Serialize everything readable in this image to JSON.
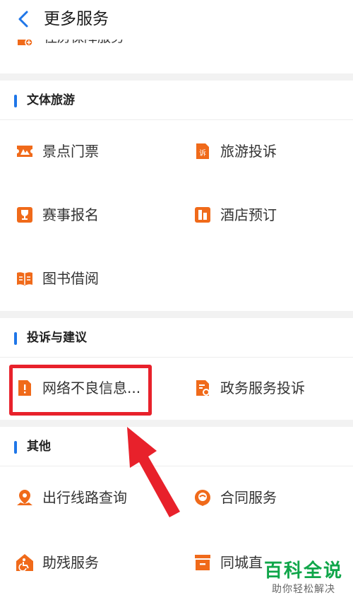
{
  "header": {
    "title": "更多服务"
  },
  "partial_item": {
    "label": "住房保障服务"
  },
  "sections": [
    {
      "title": "文体旅游",
      "items": [
        {
          "label": "景点门票",
          "icon": "ticket-icon"
        },
        {
          "label": "旅游投诉",
          "icon": "complaint-doc-icon"
        },
        {
          "label": "赛事报名",
          "icon": "trophy-icon"
        },
        {
          "label": "酒店预订",
          "icon": "hotel-icon"
        },
        {
          "label": "图书借阅",
          "icon": "book-icon"
        }
      ]
    },
    {
      "title": "投诉与建议",
      "items": [
        {
          "label": "网络不良信息...",
          "icon": "report-doc-icon"
        },
        {
          "label": "政务服务投诉",
          "icon": "gov-complaint-icon"
        }
      ]
    },
    {
      "title": "其他",
      "items": [
        {
          "label": "出行线路查询",
          "icon": "location-pin-icon"
        },
        {
          "label": "合同服务",
          "icon": "contract-icon"
        },
        {
          "label": "助残服务",
          "icon": "accessibility-icon"
        },
        {
          "label": "同城直",
          "icon": "delivery-box-icon"
        }
      ]
    }
  ],
  "watermark": {
    "main": "百科全说",
    "sub": "助你轻松解决"
  },
  "colors": {
    "accent_blue": "#1f76e8",
    "icon_orange": "#f06a1a",
    "highlight_red": "#e8212b",
    "watermark_green": "#10a64a"
  }
}
